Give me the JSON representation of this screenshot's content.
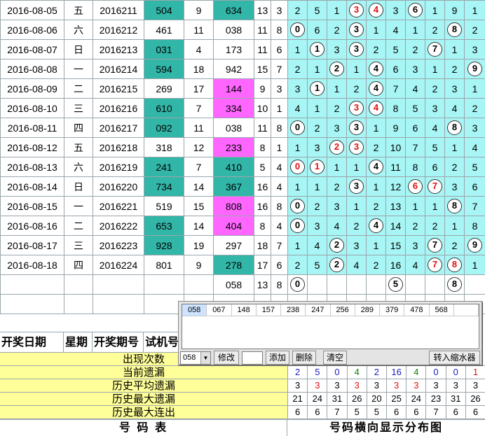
{
  "rows": [
    {
      "date": "2016-08-05",
      "week": "五",
      "issue": "2016211",
      "test": "504",
      "span": "9",
      "draw": "634",
      "sum": "13",
      "kd": "3",
      "dist": [
        "2",
        "5",
        "1",
        "3",
        "4",
        "3",
        "6",
        "1",
        "9",
        "1"
      ],
      "balls": {
        "3": "red",
        "4": "red",
        "6": "black"
      }
    },
    {
      "date": "2016-08-06",
      "week": "六",
      "issue": "2016212",
      "test": "461",
      "span": "11",
      "draw": "038",
      "sum": "11",
      "kd": "8",
      "dist": [
        "0",
        "6",
        "2",
        "3",
        "1",
        "4",
        "1",
        "2",
        "8",
        "2"
      ],
      "balls": {
        "0": "black",
        "3": "black",
        "8": "black"
      }
    },
    {
      "date": "2016-08-07",
      "week": "日",
      "issue": "2016213",
      "test": "031",
      "span": "4",
      "draw": "173",
      "sum": "11",
      "kd": "6",
      "dist": [
        "1",
        "1",
        "3",
        "3",
        "2",
        "5",
        "2",
        "7",
        "1",
        "3"
      ],
      "balls": {
        "1": "black",
        "3": "black",
        "7": "black"
      }
    },
    {
      "date": "2016-08-08",
      "week": "一",
      "issue": "2016214",
      "test": "594",
      "span": "18",
      "draw": "942",
      "sum": "15",
      "kd": "7",
      "dist": [
        "2",
        "1",
        "2",
        "1",
        "4",
        "6",
        "3",
        "1",
        "2",
        "9"
      ],
      "balls": {
        "2": "black",
        "4": "black",
        "9": "black"
      }
    },
    {
      "date": "2016-08-09",
      "week": "二",
      "issue": "2016215",
      "test": "269",
      "span": "17",
      "draw": "144",
      "sum": "9",
      "kd": "3",
      "dist": [
        "3",
        "1",
        "1",
        "2",
        "4",
        "7",
        "4",
        "2",
        "3",
        "1"
      ],
      "balls": {
        "1": "black",
        "4": "black"
      }
    },
    {
      "date": "2016-08-10",
      "week": "三",
      "issue": "2016216",
      "test": "610",
      "span": "7",
      "draw": "334",
      "sum": "10",
      "kd": "1",
      "dist": [
        "4",
        "1",
        "2",
        "3",
        "4",
        "8",
        "5",
        "3",
        "4",
        "2"
      ],
      "balls": {
        "3": "red",
        "4": "red"
      }
    },
    {
      "date": "2016-08-11",
      "week": "四",
      "issue": "2016217",
      "test": "092",
      "span": "11",
      "draw": "038",
      "sum": "11",
      "kd": "8",
      "dist": [
        "0",
        "2",
        "3",
        "3",
        "1",
        "9",
        "6",
        "4",
        "8",
        "3"
      ],
      "balls": {
        "0": "black",
        "3": "black",
        "8": "black"
      }
    },
    {
      "date": "2016-08-12",
      "week": "五",
      "issue": "2016218",
      "test": "318",
      "span": "12",
      "draw": "233",
      "sum": "8",
      "kd": "1",
      "dist": [
        "1",
        "3",
        "2",
        "3",
        "2",
        "10",
        "7",
        "5",
        "1",
        "4"
      ],
      "balls": {
        "2": "red",
        "3": "red"
      }
    },
    {
      "date": "2016-08-13",
      "week": "六",
      "issue": "2016219",
      "test": "241",
      "span": "7",
      "draw": "410",
      "sum": "5",
      "kd": "4",
      "dist": [
        "0",
        "1",
        "1",
        "1",
        "4",
        "11",
        "8",
        "6",
        "2",
        "5"
      ],
      "balls": {
        "0": "red",
        "1": "red",
        "4": "black"
      }
    },
    {
      "date": "2016-08-14",
      "week": "日",
      "issue": "2016220",
      "test": "734",
      "span": "14",
      "draw": "367",
      "sum": "16",
      "kd": "4",
      "dist": [
        "1",
        "1",
        "2",
        "3",
        "1",
        "12",
        "6",
        "7",
        "3",
        "6"
      ],
      "balls": {
        "3": "black",
        "6": "red",
        "7": "red"
      }
    },
    {
      "date": "2016-08-15",
      "week": "一",
      "issue": "2016221",
      "test": "519",
      "span": "15",
      "draw": "808",
      "sum": "16",
      "kd": "8",
      "dist": [
        "0",
        "2",
        "3",
        "1",
        "2",
        "13",
        "1",
        "1",
        "8",
        "7"
      ],
      "balls": {
        "0": "black",
        "8": "black"
      }
    },
    {
      "date": "2016-08-16",
      "week": "二",
      "issue": "2016222",
      "test": "653",
      "span": "14",
      "draw": "404",
      "sum": "8",
      "kd": "4",
      "dist": [
        "0",
        "3",
        "4",
        "2",
        "4",
        "14",
        "2",
        "2",
        "1",
        "8"
      ],
      "balls": {
        "0": "black",
        "4": "black"
      }
    },
    {
      "date": "2016-08-17",
      "week": "三",
      "issue": "2016223",
      "test": "928",
      "span": "19",
      "draw": "297",
      "sum": "18",
      "kd": "7",
      "dist": [
        "1",
        "4",
        "2",
        "3",
        "1",
        "15",
        "3",
        "7",
        "2",
        "9"
      ],
      "balls": {
        "2": "black",
        "7": "black",
        "9": "black"
      }
    },
    {
      "date": "2016-08-18",
      "week": "四",
      "issue": "2016224",
      "test": "801",
      "span": "9",
      "draw": "278",
      "sum": "17",
      "kd": "6",
      "dist": [
        "2",
        "5",
        "2",
        "4",
        "2",
        "16",
        "4",
        "7",
        "8",
        "1"
      ],
      "balls": {
        "2": "black",
        "7": "red",
        "8": "red"
      }
    }
  ],
  "trial_row": {
    "draw": "058",
    "sum": "13",
    "kd": "8",
    "balls": {
      "0": "0",
      "5": "5",
      "8": "8"
    }
  },
  "header": {
    "date": "开奖日期",
    "week": "星期",
    "issue": "开奖期号",
    "test": "试机号"
  },
  "summary": [
    {
      "label": "出现次数",
      "values": [
        "",
        "",
        "",
        "",
        "",
        "",
        "",
        "",
        "",
        ""
      ]
    },
    {
      "label": "当前遗漏",
      "values": [
        "2",
        "5",
        "0",
        "4",
        "2",
        "16",
        "4",
        "0",
        "0",
        "1"
      ],
      "colors": [
        "blue",
        "blue",
        "blue",
        "green",
        "blue",
        "blue",
        "green",
        "blue",
        "blue",
        "red"
      ]
    },
    {
      "label": "历史平均遗漏",
      "values": [
        "3",
        "3",
        "3",
        "3",
        "3",
        "3",
        "3",
        "3",
        "3",
        "3"
      ],
      "colors": [
        "black",
        "red",
        "black",
        "red",
        "black",
        "red",
        "red",
        "black",
        "black",
        "black"
      ]
    },
    {
      "label": "历史最大遗漏",
      "values": [
        "21",
        "24",
        "31",
        "26",
        "20",
        "25",
        "24",
        "23",
        "31",
        "26"
      ]
    },
    {
      "label": "历史最大连出",
      "values": [
        "6",
        "6",
        "7",
        "5",
        "5",
        "6",
        "6",
        "7",
        "6",
        "6"
      ]
    }
  ],
  "footer": {
    "left": "号 码 表",
    "right": "号码横向显示分布图"
  },
  "popup": {
    "items": [
      "058",
      "067",
      "148",
      "157",
      "238",
      "247",
      "256",
      "289",
      "379",
      "478",
      "568",
      ""
    ],
    "combo": "058",
    "btn_edit": "修改",
    "btn_add": "添加",
    "btn_delete": "删除",
    "btn_clear": "清空",
    "btn_shrink": "转入缩水器"
  },
  "colors": {
    "teal": "#32b6a8",
    "pink": "#ff66ff",
    "dist_bg": "#a7f5f4",
    "summary_bg": "#ffff99"
  }
}
